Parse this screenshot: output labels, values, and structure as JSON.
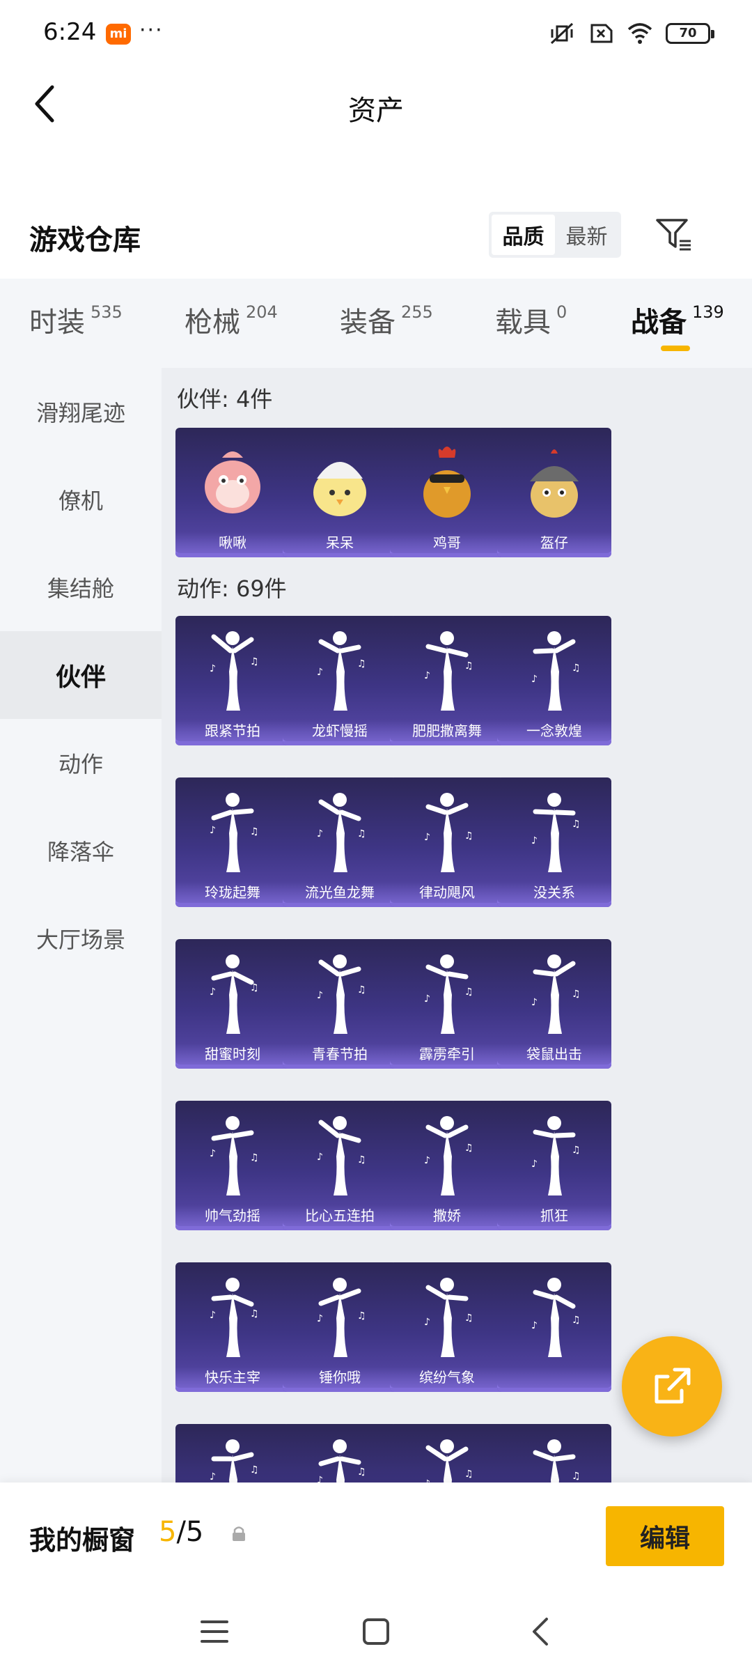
{
  "status": {
    "time": "6:24",
    "mi": "mi",
    "dots": "···",
    "battery": "70"
  },
  "header": {
    "title": "资产"
  },
  "warehouse": {
    "title": "游戏仓库",
    "sort_options": [
      "品质",
      "最新"
    ]
  },
  "categories": [
    {
      "label": "时装",
      "count": "535"
    },
    {
      "label": "枪械",
      "count": "204"
    },
    {
      "label": "装备",
      "count": "255"
    },
    {
      "label": "载具",
      "count": "0"
    },
    {
      "label": "战备",
      "count": "139"
    }
  ],
  "sidebar": [
    "滑翔尾迹",
    "僚机",
    "集结舱",
    "伙伴",
    "动作",
    "降落伞",
    "大厅场景"
  ],
  "sections": {
    "partner_title": "伙伴: 4件",
    "partners": [
      "啾啾",
      "呆呆",
      "鸡哥",
      "盔仔"
    ],
    "action_title": "动作: 69件",
    "actions": [
      "跟紧节拍",
      "龙虾慢摇",
      "肥肥撒离舞",
      "一念敦煌",
      "玲珑起舞",
      "流光鱼龙舞",
      "律动飓风",
      "没关系",
      "甜蜜时刻",
      "青春节拍",
      "霹雳牵引",
      "袋鼠出击",
      "帅气劲摇",
      "比心五连拍",
      "撒娇",
      "抓狂",
      "快乐主宰",
      "锤你哦",
      "缤纷气象",
      ""
    ]
  },
  "showcase": {
    "label": "我的橱窗",
    "current": "5",
    "total": "/5"
  },
  "edit_label": "编辑",
  "colors": {
    "accent": "#f7b500",
    "card": "#3e3585"
  }
}
